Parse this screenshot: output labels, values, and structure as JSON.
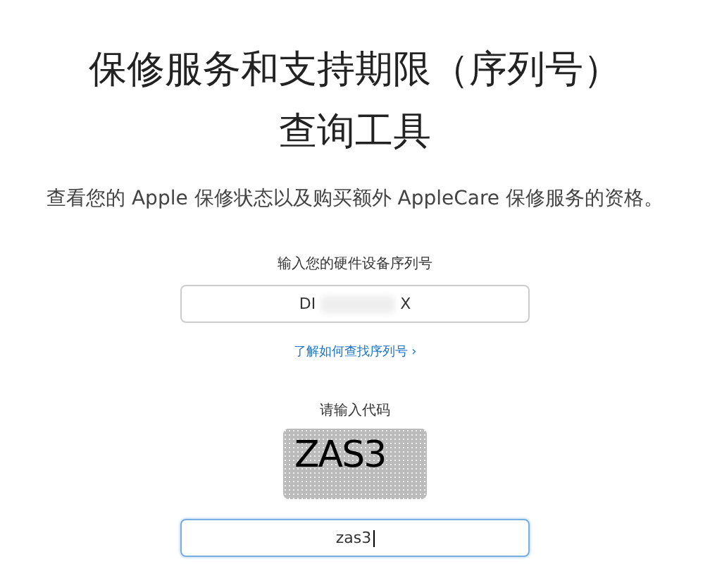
{
  "title_lines": [
    "保修服务和支持期限（序列号）",
    "查询工具"
  ],
  "subtitle": "查看您的 Apple 保修状态以及购买额外 AppleCare 保修服务的资格。",
  "serial": {
    "label": "输入您的硬件设备序列号",
    "value_start": "DI",
    "value_end": "X",
    "redacted": true,
    "focused": false
  },
  "help_link": "了解如何查找序列号 ›",
  "captcha": {
    "label": "请输入代码",
    "code": "ZAS3"
  },
  "code_field": {
    "value": "zas3",
    "focused": true
  }
}
